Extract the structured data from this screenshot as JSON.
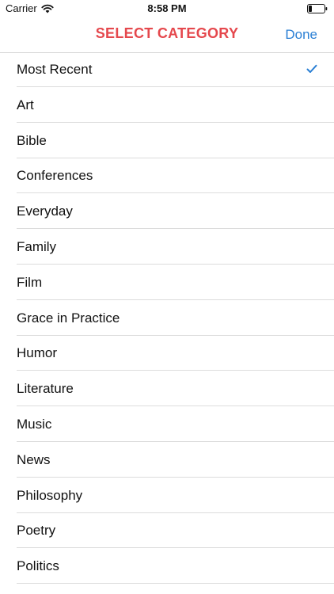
{
  "status_bar": {
    "carrier": "Carrier",
    "time": "8:58 PM"
  },
  "nav": {
    "title": "SELECT CATEGORY",
    "done_label": "Done"
  },
  "colors": {
    "title": "#e5484d",
    "accent": "#2a7fd4"
  },
  "icons": {
    "wifi": "wifi-icon",
    "battery": "battery-icon",
    "selected": "checkmark-icon"
  },
  "categories": {
    "selected": "Most Recent",
    "items": [
      "Most Recent",
      "Art",
      "Bible",
      "Conferences",
      "Everyday",
      "Family",
      "Film",
      "Grace in Practice",
      "Humor",
      "Literature",
      "Music",
      "News",
      "Philosophy",
      "Poetry",
      "Politics"
    ]
  }
}
